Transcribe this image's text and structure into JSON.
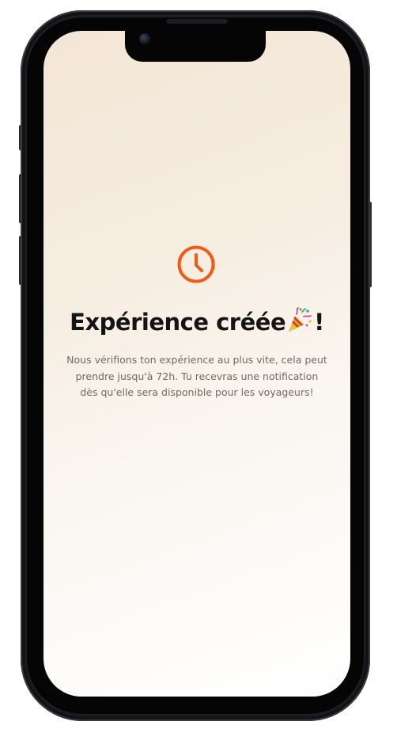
{
  "confirmation": {
    "title_main": "Expérience créée",
    "title_end": "!",
    "icons": {
      "status": "clock-icon",
      "celebration": "party-popper-icon"
    },
    "message": "Nous vérifions ton expérience au plus vite, cela peut prendre jusqu'à 72h. Tu recevras une notification dès qu'elle sera disponible pour les voyageurs!"
  },
  "colors": {
    "accent": "#f05a14",
    "title": "#141414",
    "body_text": "#6f6a64",
    "background_start": "#f3e6d5",
    "background_end": "#ffffff"
  }
}
